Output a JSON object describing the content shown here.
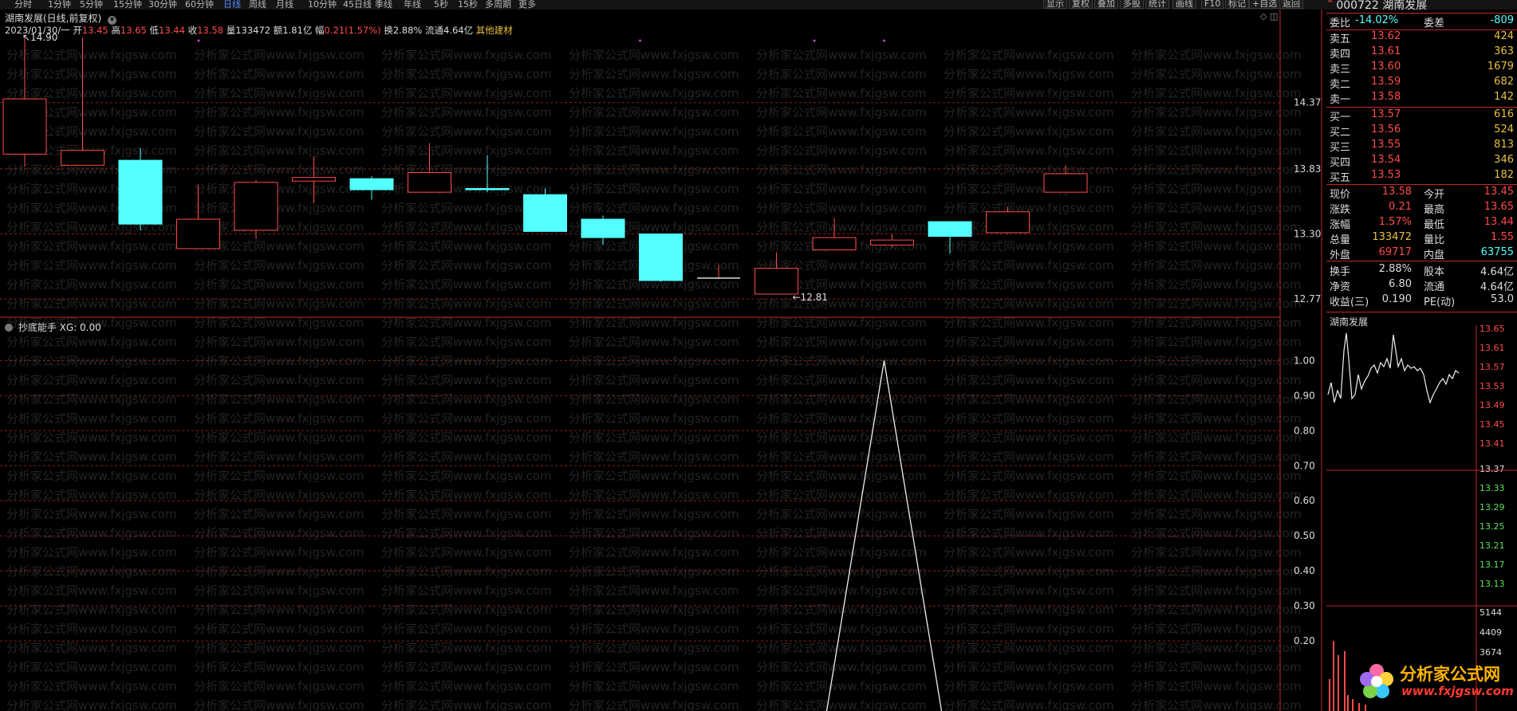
{
  "toolbar": {
    "left_items": [
      "分时",
      "1分钟",
      "5分钟",
      "15分钟",
      "30分钟",
      "60分钟",
      "日线",
      "周线",
      "月线",
      "10分钟",
      "45日线",
      "季线",
      "年线",
      "5秒",
      "15秒",
      "多周期",
      "更多"
    ],
    "active": "日线",
    "right_items": [
      "显示",
      "复权",
      "叠加",
      "多股",
      "统计",
      "画线",
      "F10",
      "标记",
      "+自选",
      "返回"
    ]
  },
  "chart_header": {
    "title": "湖南发展(日线,前复权)",
    "date": "2023/01/30/一",
    "open_label": "开",
    "open": "13.45",
    "high_label": "高",
    "high": "13.65",
    "low_label": "低",
    "low": "13.44",
    "close_label": "收",
    "close": "13.58",
    "vol_label": "量",
    "vol": "133472",
    "amt_label": "额",
    "amt": "1.81亿",
    "chg_label": "幅",
    "chg": "0.21(1.57%)",
    "turn_label": "换",
    "turn": "2.88%",
    "float_label": "流通",
    "float": "4.64亿",
    "sector": "其他建材"
  },
  "indicator_header": {
    "name": "抄底能手",
    "value_text": "XG: 0.00"
  },
  "watermark": "分析家公式网www.fxjgsw.com",
  "chart_data": [
    {
      "type": "candlestick",
      "series": [
        {
          "open": 13.95,
          "close": 14.4,
          "high": 14.9,
          "low": 13.85
        },
        {
          "open": 13.86,
          "close": 13.98,
          "high": 14.9,
          "low": 13.86
        },
        {
          "open": 13.9,
          "close": 13.38,
          "high": 14.0,
          "low": 13.33
        },
        {
          "open": 13.18,
          "close": 13.42,
          "high": 13.7,
          "low": 13.18
        },
        {
          "open": 13.33,
          "close": 13.72,
          "high": 13.74,
          "low": 13.26
        },
        {
          "open": 13.73,
          "close": 13.76,
          "high": 13.93,
          "low": 13.55
        },
        {
          "open": 13.75,
          "close": 13.66,
          "high": 13.77,
          "low": 13.58
        },
        {
          "open": 13.64,
          "close": 13.8,
          "high": 14.04,
          "low": 13.64
        },
        {
          "open": 13.67,
          "close": 13.66,
          "high": 13.94,
          "low": 13.64
        },
        {
          "open": 13.62,
          "close": 13.32,
          "high": 13.67,
          "low": 13.32
        },
        {
          "open": 13.42,
          "close": 13.27,
          "high": 13.45,
          "low": 13.21
        },
        {
          "open": 13.3,
          "close": 12.92,
          "high": 13.3,
          "low": 12.91
        },
        {
          "open": 12.94,
          "close": 12.94,
          "high": 13.05,
          "low": 12.94
        },
        {
          "open": 12.81,
          "close": 13.02,
          "high": 13.15,
          "low": 12.81
        },
        {
          "open": 13.17,
          "close": 13.27,
          "high": 13.43,
          "low": 13.17
        },
        {
          "open": 13.21,
          "close": 13.25,
          "high": 13.3,
          "low": 13.19
        },
        {
          "open": 13.4,
          "close": 13.28,
          "high": 13.4,
          "low": 13.14
        },
        {
          "open": 13.31,
          "close": 13.48,
          "high": 13.52,
          "low": 13.3
        },
        {
          "open": 13.64,
          "close": 13.79,
          "high": 13.86,
          "low": 13.64
        }
      ],
      "ylim": [
        12.66,
        15.05
      ],
      "yticks": [
        "14.37",
        "13.83",
        "13.30",
        "12.77"
      ],
      "annotations": [
        "14.90",
        "12.81"
      ]
    },
    {
      "type": "line",
      "name": "XG",
      "values": [
        0,
        0,
        0,
        0,
        0,
        0,
        0,
        0,
        0,
        0,
        0,
        0,
        0,
        0,
        0,
        1,
        0,
        0,
        0
      ],
      "ylim": [
        0.0,
        1.06
      ],
      "yticks": [
        "1.00",
        "0.90",
        "0.80",
        "0.70",
        "0.60",
        "0.50",
        "0.40",
        "0.30",
        "0.20"
      ]
    }
  ],
  "quote": {
    "code": "000722",
    "name": "湖南发展",
    "weibi_label": "委比",
    "weibi": "-14.02%",
    "weicha_label": "委差",
    "weicha": "-809",
    "asks": [
      {
        "label": "卖五",
        "price": "13.62",
        "vol": "424"
      },
      {
        "label": "卖四",
        "price": "13.61",
        "vol": "363"
      },
      {
        "label": "卖三",
        "price": "13.60",
        "vol": "1679"
      },
      {
        "label": "卖二",
        "price": "13.59",
        "vol": "682"
      },
      {
        "label": "卖一",
        "price": "13.58",
        "vol": "142"
      }
    ],
    "bids": [
      {
        "label": "买一",
        "price": "13.57",
        "vol": "616"
      },
      {
        "label": "买二",
        "price": "13.56",
        "vol": "524"
      },
      {
        "label": "买三",
        "price": "13.55",
        "vol": "813"
      },
      {
        "label": "买四",
        "price": "13.54",
        "vol": "346"
      },
      {
        "label": "买五",
        "price": "13.53",
        "vol": "182"
      }
    ],
    "stats": [
      {
        "l1": "现价",
        "v1": "13.58",
        "l2": "今开",
        "v2": "13.45"
      },
      {
        "l1": "涨跌",
        "v1": "0.21",
        "l2": "最高",
        "v2": "13.65"
      },
      {
        "l1": "涨幅",
        "v1": "1.57%",
        "l2": "最低",
        "v2": "13.44"
      },
      {
        "l1": "总量",
        "v1": "133472",
        "l2": "量比",
        "v2": "1.55"
      },
      {
        "l1": "外盘",
        "v1": "69717",
        "l2": "内盘",
        "v2": "63755"
      }
    ],
    "stats2": [
      {
        "l1": "换手",
        "v1": "2.88%",
        "l2": "股本",
        "v2": "4.64亿"
      },
      {
        "l1": "净资",
        "v1": "6.80",
        "l2": "流通",
        "v2": "4.64亿"
      },
      {
        "l1": "收益(三)",
        "v1": "0.190",
        "l2": "PE(动)",
        "v2": "53.0"
      }
    ]
  },
  "mini_chart": {
    "title": "湖南发展",
    "price_ticks_up": [
      "13.65",
      "13.61",
      "13.57",
      "13.53",
      "13.49",
      "13.45",
      "13.41"
    ],
    "mid_tick": "13.37",
    "price_ticks_down": [
      "13.33",
      "13.29",
      "13.25",
      "13.21",
      "13.17",
      "13.13"
    ],
    "vol_ticks": [
      "5144",
      "4409",
      "3674"
    ]
  },
  "logo": {
    "text_cn": "分析家公式网",
    "text_url": "www.fxjgsw.com"
  },
  "colors": {
    "up": "#ff4a4a",
    "down": "#54ffff",
    "grid": "#8a1e1e",
    "border": "#c02828"
  }
}
